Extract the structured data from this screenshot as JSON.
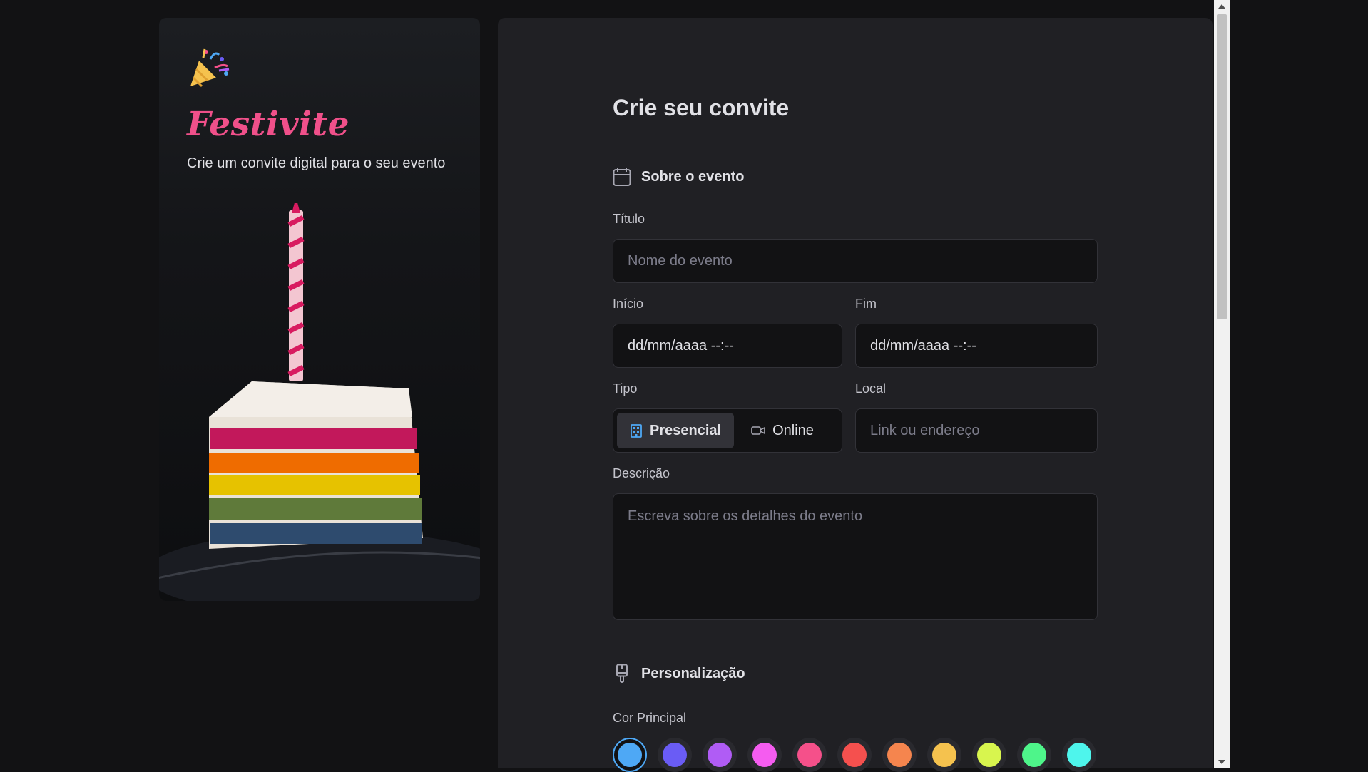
{
  "brand": {
    "name": "Festivite",
    "tagline": "Crie um convite digital para o seu evento"
  },
  "form": {
    "title": "Crie seu convite",
    "section_event": "Sobre o evento",
    "title_label": "Título",
    "title_placeholder": "Nome do evento",
    "start_label": "Início",
    "start_value": "dd/mm/aaaa --:--",
    "end_label": "Fim",
    "end_value": "dd/mm/aaaa --:--",
    "type_label": "Tipo",
    "type_options": [
      "Presencial",
      "Online"
    ],
    "type_selected": "Presencial",
    "location_label": "Local",
    "location_placeholder": "Link ou endereço",
    "description_label": "Descrição",
    "description_placeholder": "Escreva sobre os detalhes do evento",
    "section_custom": "Personalização",
    "color_label": "Cor Principal",
    "colors": [
      "#4ea8f5",
      "#6a5cf5",
      "#b05cf5",
      "#f55cf0",
      "#f5508a",
      "#f5504e",
      "#f5854e",
      "#f5c24e",
      "#d8f54e",
      "#4ef58a",
      "#4ef5ec"
    ],
    "color_selected": "#4ea8f5"
  }
}
